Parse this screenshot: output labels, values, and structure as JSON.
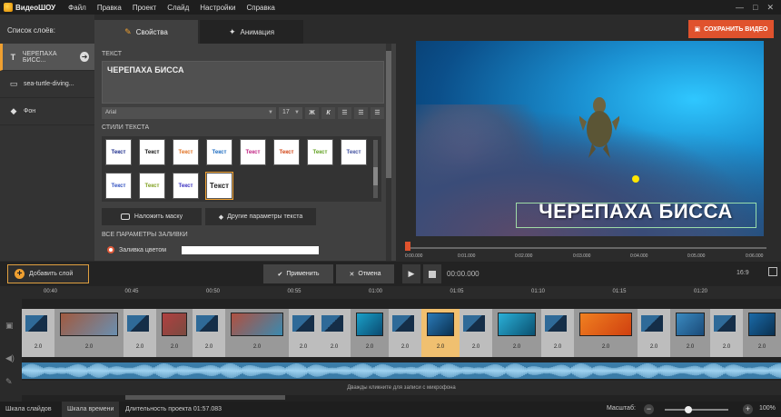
{
  "app": {
    "name": "ВидеоШОУ"
  },
  "menu": [
    "Файл",
    "Правка",
    "Проект",
    "Слайд",
    "Настройки",
    "Справка"
  ],
  "layers": {
    "title": "Список слоёв:",
    "items": [
      {
        "icon": "T",
        "label": "ЧЕРЕПАХА БИСС...",
        "active": true
      },
      {
        "icon": "film",
        "label": "sea-turtle-diving..."
      },
      {
        "icon": "fill",
        "label": "Фон"
      }
    ]
  },
  "tabs": [
    {
      "label": "Свойства",
      "active": true
    },
    {
      "label": "Анимация"
    }
  ],
  "props": {
    "text_section": "ТЕКСТ",
    "text_value": "ЧЕРЕПАХА БИССА",
    "font": "Arial",
    "size": "17",
    "styles_section": "СТИЛИ ТЕКСТА",
    "style_sample": "Текст",
    "style_colors": [
      "#1a2a8a",
      "#111111",
      "#e07020",
      "#1a6ac0",
      "#c02080",
      "#d04010",
      "#60a020",
      "#4050a0",
      "#3050c0",
      "#80a020",
      "#3a30c0",
      "#222222"
    ],
    "mask_button": "Наложить маску",
    "more_button": "Другие параметры текста",
    "fill_section": "ВСЕ ПАРАМЕТРЫ ЗАЛИВКИ",
    "fill_color_label": "Заливка цветом"
  },
  "save_button": "СОХРАНИТЬ ВИДЕО",
  "preview": {
    "caption": "ЧЕРЕПАХА БИССА"
  },
  "ruler_ticks": [
    "0:00.000",
    "0:01.000",
    "0:02.000",
    "0:03.000",
    "0:04.000",
    "0:05.000",
    "0:06.000"
  ],
  "actions": {
    "add_layer": "Добавить слой",
    "apply": "Применить",
    "cancel": "Отмена",
    "time": "00:00.000",
    "ratio": "16:9"
  },
  "timeline": {
    "marks": [
      "00:40",
      "00:45",
      "00:50",
      "00:55",
      "01:00",
      "01:05",
      "01:10",
      "01:15",
      "01:20"
    ],
    "duration_label": "2.0",
    "mic_hint": "Дважды кликните для записи с микрофона"
  },
  "status": {
    "tab_slides": "Шкала слайдов",
    "tab_timeline": "Шкала времени",
    "project_duration": "Длительность проекта 01:57.083",
    "zoom_label": "Масштаб:",
    "zoom_percent": "100%"
  }
}
